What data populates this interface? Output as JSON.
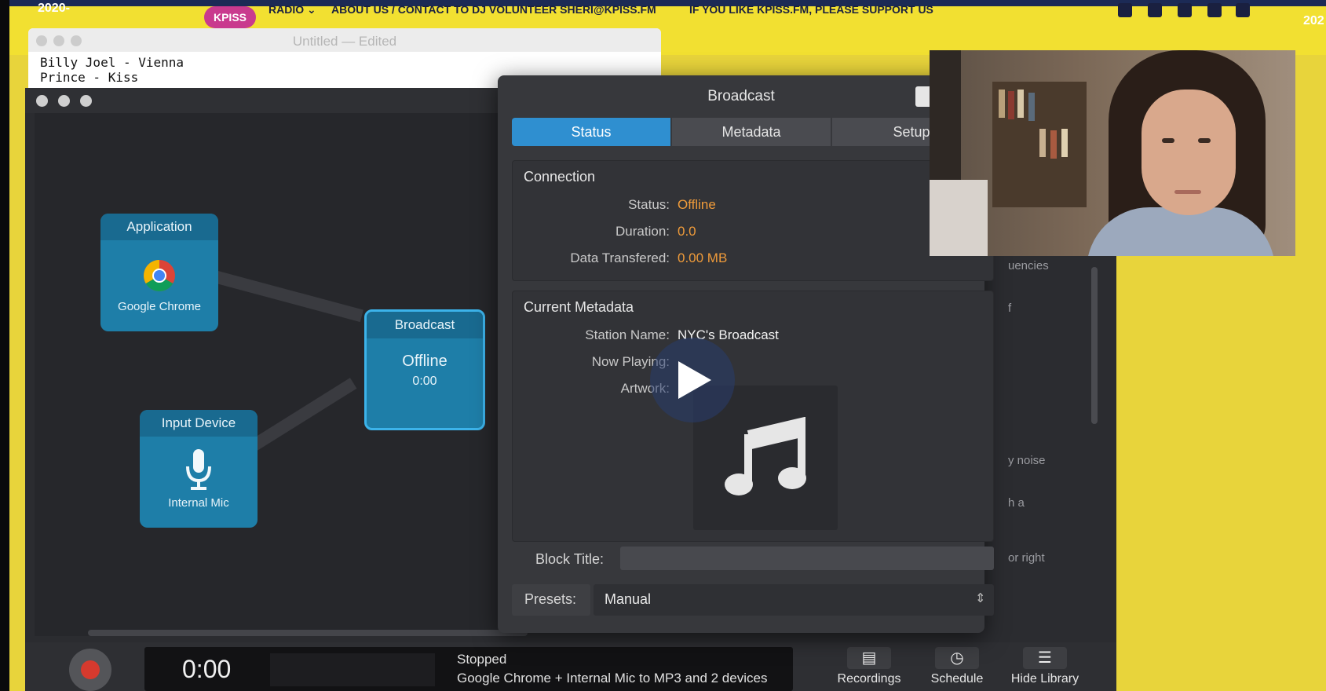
{
  "website": {
    "year_left": "2020-",
    "year_right": "202",
    "logo": "KPISS FM",
    "nav_radio": "RADIO ⌄",
    "nav_about": "ABOUT US / CONTACT TO DJ VOLUNTEER SHERI@KPISS.FM",
    "nav_support": "IF YOU LIKE KPISS.FM, PLEASE SUPPORT US"
  },
  "editor": {
    "title": "Untitled — Edited",
    "line1": "Billy Joel - Vienna",
    "line2": "Prince - Kiss"
  },
  "canvas": {
    "application_node": {
      "header": "Application",
      "label": "Google Chrome",
      "icon": "chrome-icon"
    },
    "input_node": {
      "header": "Input Device",
      "label": "Internal Mic",
      "icon": "microphone-icon"
    },
    "broadcast_node": {
      "header": "Broadcast",
      "status": "Offline",
      "time": "0:00"
    }
  },
  "dialog": {
    "title": "Broadcast",
    "tabs": [
      "Status",
      "Metadata",
      "Setup"
    ],
    "active_tab": "Status",
    "connection": {
      "heading": "Connection",
      "status_label": "Status:",
      "status_value": "Offline",
      "duration_label": "Duration:",
      "duration_value": "0.0",
      "data_label": "Data Transfered:",
      "data_value": "0.00 MB"
    },
    "metadata": {
      "heading": "Current Metadata",
      "station_label": "Station Name:",
      "station_value": "NYC's Broadcast",
      "now_playing_label": "Now Playing:",
      "artwork_label": "Artwork:"
    },
    "block_title_label": "Block Title:",
    "presets_label": "Presets:",
    "presets_value": "Manual"
  },
  "library_fragments": [
    "uencies",
    "f",
    "y noise",
    "h a",
    "or right"
  ],
  "transport": {
    "time": "0:00",
    "status": "Stopped",
    "description": "Google Chrome + Internal Mic to MP3 and 2 devices",
    "buttons": [
      {
        "label": "Recordings",
        "icon": "recordings-icon"
      },
      {
        "label": "Schedule",
        "icon": "clock-icon"
      },
      {
        "label": "Hide Library",
        "icon": "list-icon"
      }
    ]
  },
  "colors": {
    "accent": "#2f8fd0",
    "offline": "#ef9b3a",
    "node": "#1e7ea8",
    "site_yellow": "#f2e031"
  }
}
